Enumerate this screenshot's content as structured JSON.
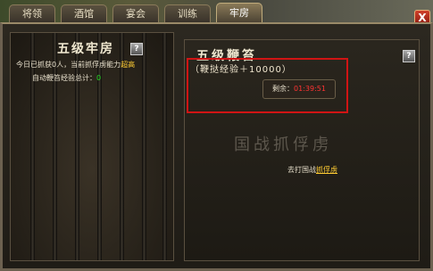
{
  "tabs": [
    {
      "label": "将领",
      "active": false
    },
    {
      "label": "酒馆",
      "active": false
    },
    {
      "label": "宴会",
      "active": false
    },
    {
      "label": "训练",
      "active": false
    },
    {
      "label": "牢房",
      "active": true
    }
  ],
  "close_label": "X",
  "left": {
    "title": "五级牢房",
    "help": "?",
    "line1_prefix": "今日已抓获0人，当前抓俘虏能力",
    "line1_value": "超高",
    "line2_prefix": "自动鞭笞经验总计：",
    "line2_value": "0"
  },
  "right": {
    "title": "五级鞭笞",
    "help": "?",
    "reward": "（鞭挞经验＋10000）",
    "timer_label": "剩余：",
    "timer_value": "01:39:51",
    "big_text": "国战抓俘虏",
    "link_prefix": "去打国战",
    "link_text": "抓俘虏"
  },
  "colors": {
    "accent_yellow": "#ffcc33",
    "green": "#22dd22",
    "timer_red": "#ff3333",
    "highlight_box": "#d01414"
  }
}
